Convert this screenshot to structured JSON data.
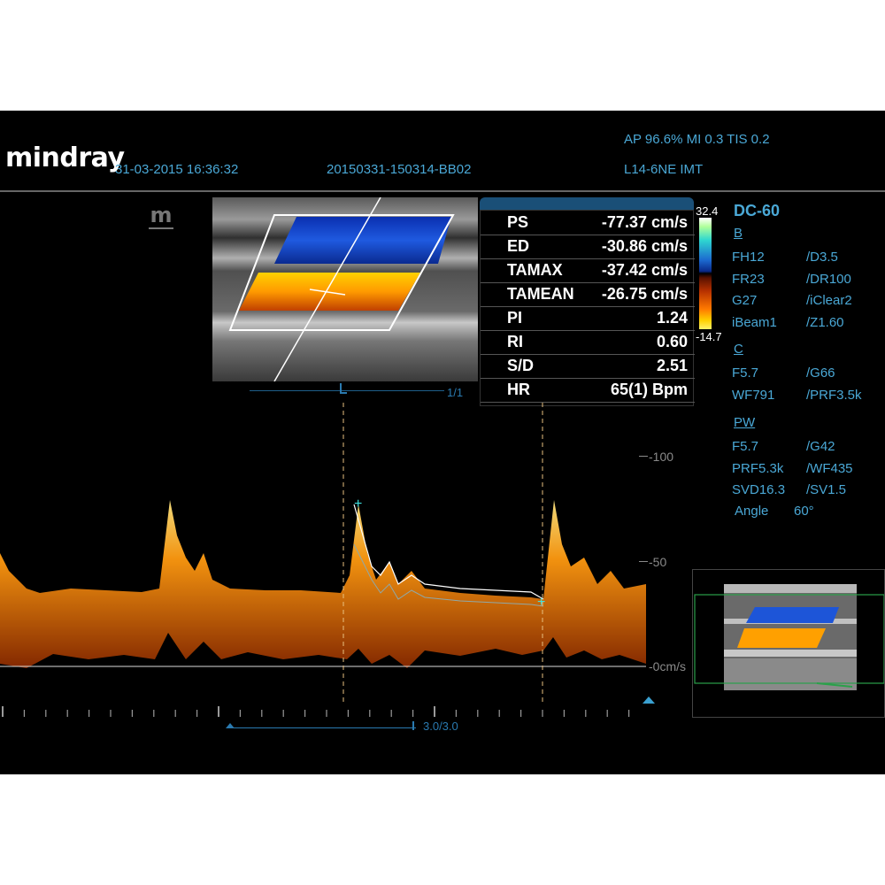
{
  "header": {
    "brand": "mindray",
    "datetime": "31-03-2015 16:36:32",
    "patient_id": "20150331-150314-BB02",
    "ap_mi_tis": "AP 96.6%  MI 0.3 TIS 0.2",
    "probe_preset": "L14-6NE  IMT"
  },
  "image_controls": {
    "m_logo": "m",
    "frame_counter": "1/1",
    "cine_counter": "3.0/3.0"
  },
  "measurements": [
    {
      "label": "PS",
      "value": "-77.37 cm/s"
    },
    {
      "label": "ED",
      "value": "-30.86 cm/s"
    },
    {
      "label": "TAMAX",
      "value": "-37.42 cm/s"
    },
    {
      "label": "TAMEAN",
      "value": "-26.75 cm/s"
    },
    {
      "label": "PI",
      "value": "1.24"
    },
    {
      "label": "RI",
      "value": "0.60"
    },
    {
      "label": "S/D",
      "value": "2.51"
    },
    {
      "label": "HR",
      "value": "65(1) Bpm"
    }
  ],
  "color_scale": {
    "max": "32.4",
    "min": "-14.7"
  },
  "params": {
    "mode": "DC-60",
    "b_title": "B",
    "b": [
      [
        "FH12",
        "/D3.5"
      ],
      [
        "FR23",
        "/DR100"
      ],
      [
        "G27",
        "/iClear2"
      ],
      [
        "iBeam1",
        "/Z1.60"
      ]
    ],
    "c_title": "C",
    "c": [
      [
        "F5.7",
        "/G66"
      ],
      [
        "WF791",
        "/PRF3.5k"
      ]
    ],
    "pw_title": "PW",
    "pw": [
      [
        "F5.7",
        "/G42"
      ],
      [
        "PRF5.3k",
        "/WF435"
      ],
      [
        "SVD16.3",
        "/SV1.5"
      ]
    ],
    "angle_label": "Angle",
    "angle_value": "60°"
  },
  "velocity_scale": {
    "t100": "-100",
    "t50": "-50",
    "t0": "-0cm/s"
  },
  "colors": {
    "accent": "#4aa8d6",
    "background": "#000000",
    "doppler": "#ff9a10",
    "marker": "#3fe0e0"
  }
}
